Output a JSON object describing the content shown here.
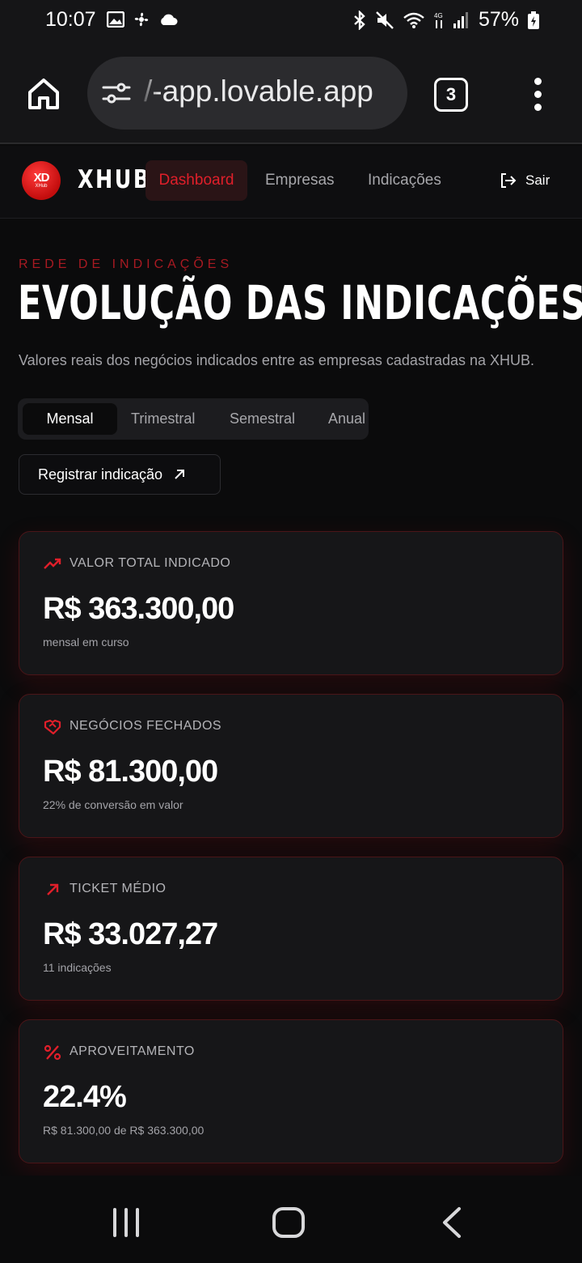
{
  "status_bar": {
    "time": "10:07",
    "battery": "57%",
    "icons": [
      "image-icon",
      "fan-icon",
      "cloud-icon",
      "bluetooth-icon",
      "mute-icon",
      "wifi-icon",
      "4g-icon",
      "signal-icon",
      "battery-icon"
    ]
  },
  "browser": {
    "url": "/-app.lovable.app",
    "tab_count": "3"
  },
  "app": {
    "brand": "XHUB",
    "logo_mark": "XD",
    "logo_sub": "XHub",
    "nav": {
      "dashboard": "Dashboard",
      "empresas": "Empresas",
      "indicacoes": "Indicações"
    },
    "logout": "Sair",
    "accent": "#e01f2a"
  },
  "hero": {
    "eyebrow": "REDE DE INDICAÇÕES",
    "title": "EVOLUÇÃO DAS INDICAÇÕES",
    "subtitle": "Valores reais dos negócios indicados entre as empresas cadastradas na XHUB."
  },
  "period_tabs": {
    "mensal": "Mensal",
    "trimestral": "Trimestral",
    "semestral": "Semestral",
    "anual": "Anual",
    "selected": "Mensal"
  },
  "register_button": "Registrar indicação",
  "cards": [
    {
      "icon": "trending-up-icon",
      "label": "VALOR TOTAL INDICADO",
      "value": "R$ 363.300,00",
      "sub": "mensal em curso"
    },
    {
      "icon": "handshake-icon",
      "label": "NEGÓCIOS FECHADOS",
      "value": "R$ 81.300,00",
      "sub": "22% de conversão em valor"
    },
    {
      "icon": "arrow-up-right-icon",
      "label": "TICKET MÉDIO",
      "value": "R$ 33.027,27",
      "sub": "11 indicações"
    },
    {
      "icon": "percent-icon",
      "label": "APROVEITAMENTO",
      "value": "22.4%",
      "sub": "R$ 81.300,00 de R$ 363.300,00"
    }
  ]
}
